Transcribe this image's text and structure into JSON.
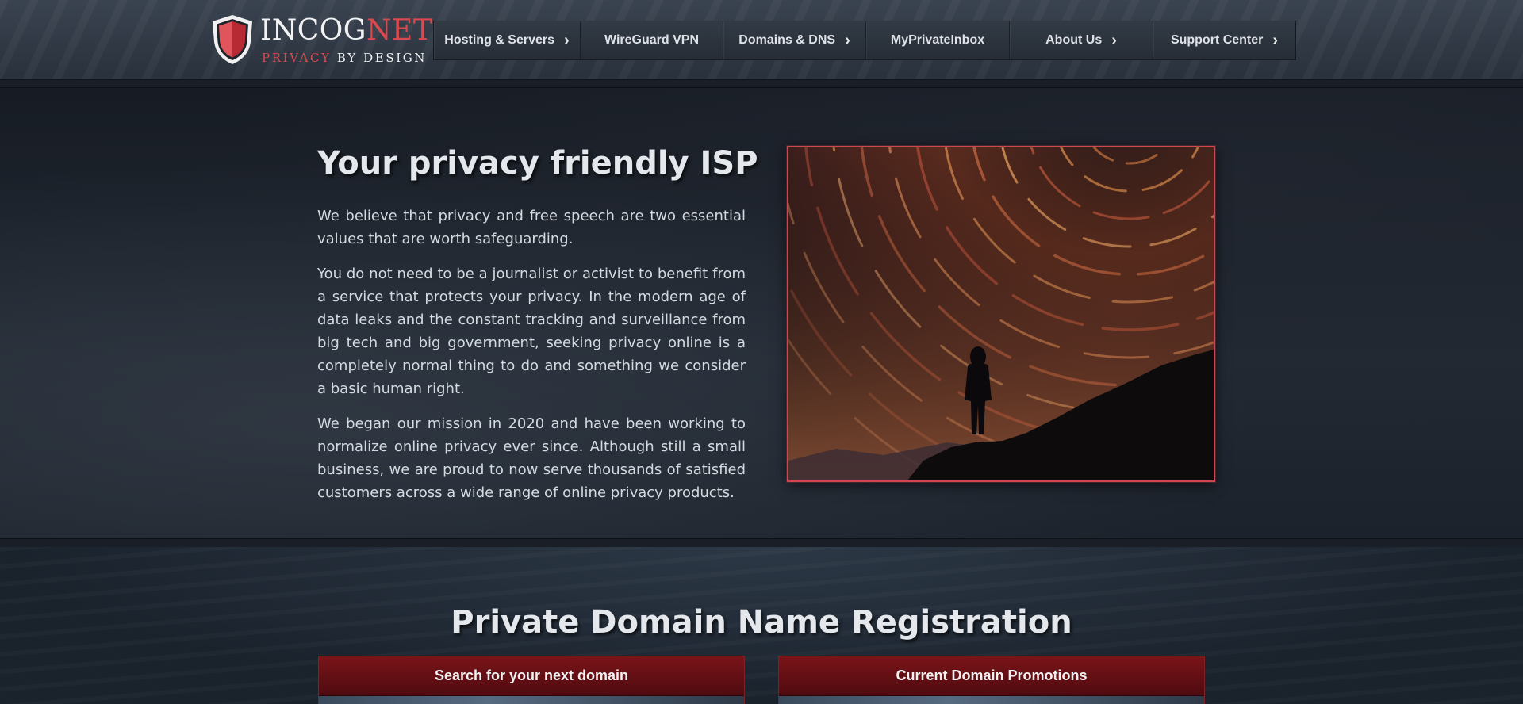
{
  "brand": {
    "name_part1": "INCOG",
    "name_part2": "NET",
    "tag_part1": "PRIVACY",
    "tag_part2": "BY DESIGN",
    "accent_color": "#d84a4f"
  },
  "nav": {
    "items": [
      {
        "label": "Hosting & Servers",
        "has_submenu": true
      },
      {
        "label": "WireGuard VPN",
        "has_submenu": false
      },
      {
        "label": "Domains & DNS",
        "has_submenu": true
      },
      {
        "label": "MyPrivateInbox",
        "has_submenu": false
      },
      {
        "label": "About Us",
        "has_submenu": true
      },
      {
        "label": "Support Center",
        "has_submenu": true
      }
    ],
    "submenu_icon": "chevron-right-icon"
  },
  "about": {
    "title": "Your privacy friendly ISP",
    "paragraphs": [
      "We believe that privacy and free speech are two essential values that are worth safeguarding.",
      "You do not need to be a journalist or activist to benefit from a service that protects your privacy. In the modern age of data leaks and the constant tracking and surveillance from big tech and big government, seeking privacy online is a completely normal thing to do and something we consider a basic human right.",
      "We began our mission in 2020 and have been working to normalize online privacy ever since. Although still a small business, we are proud to now serve thousands of satisfied customers across a wide range of online privacy products."
    ],
    "image_border_color": "#d2444f"
  },
  "domains": {
    "title": "Private Domain Name Registration",
    "panels": [
      {
        "heading": "Search for your next domain"
      },
      {
        "heading": "Current Domain Promotions"
      }
    ]
  }
}
